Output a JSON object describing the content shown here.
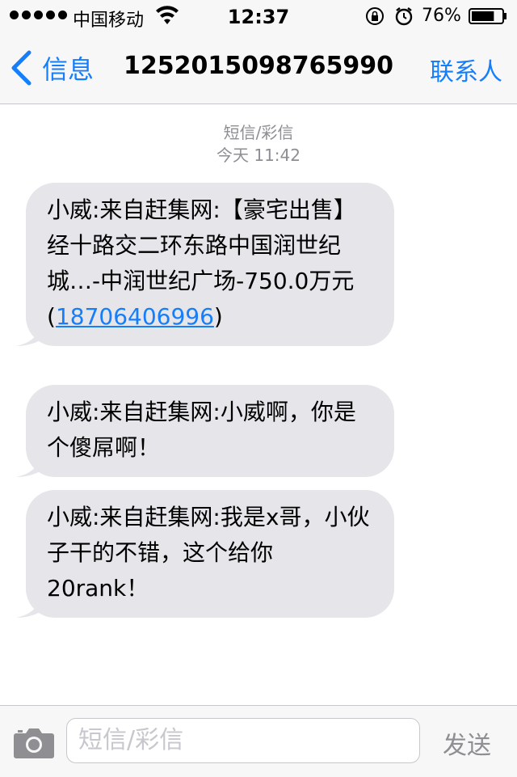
{
  "status_bar": {
    "carrier": "中国移动",
    "time": "12:37",
    "battery_percent": "76%",
    "battery_level": 0.76
  },
  "nav": {
    "back_label": "信息",
    "title": "1252015098765990",
    "contacts_label": "联系人"
  },
  "thread_header": {
    "type": "短信/彩信",
    "timestamp": "今天 11:42"
  },
  "messages": [
    {
      "text": "小威:来自赶集网:【豪宅出售】经十路交二环东路中国润世纪城…-中润世纪广场-750.0万元(",
      "link": "18706406996",
      "text_after": ")"
    },
    {
      "text": "小威:来自赶集网:小威啊，你是个傻屌啊！"
    },
    {
      "text": "小威:来自赶集网:我是x哥，小伙子干的不错，这个给你20rank！"
    }
  ],
  "composer": {
    "placeholder": "短信/彩信",
    "send_label": "发送"
  },
  "colors": {
    "accent": "#157efb",
    "bubble": "#e5e5ea",
    "bar": "#f7f7f7",
    "meta_text": "#8e8e93"
  }
}
